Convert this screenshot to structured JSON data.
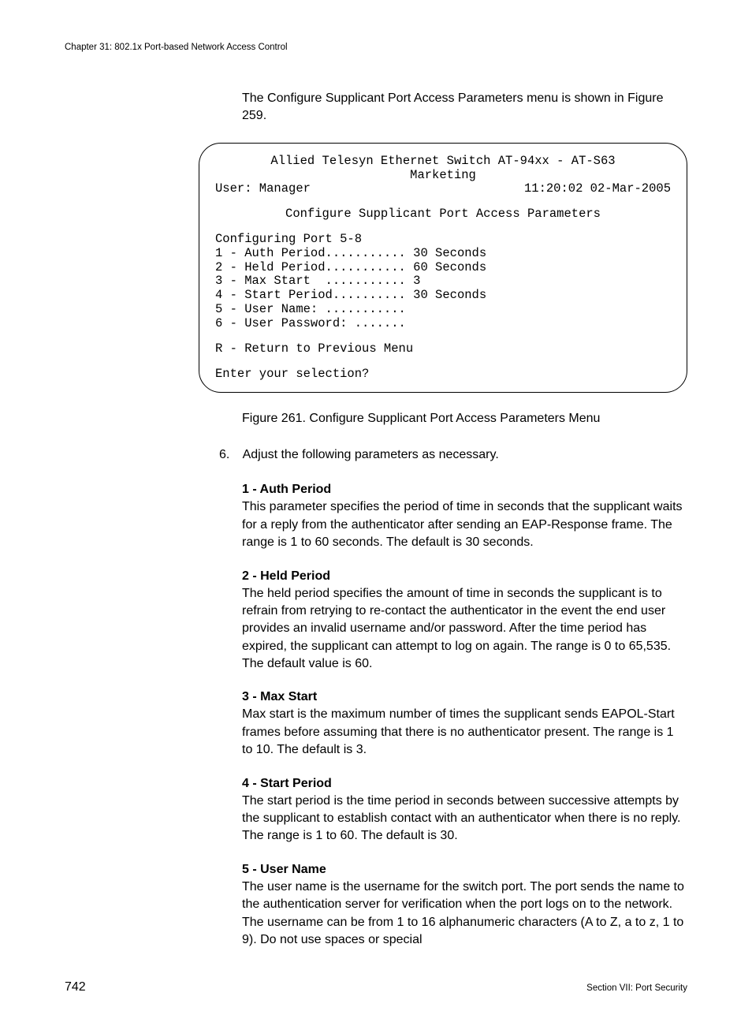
{
  "header": {
    "chapter": "Chapter 31: 802.1x Port-based Network Access Control"
  },
  "intro": "The Configure Supplicant Port Access Parameters menu is shown in Figure 259.",
  "terminal": {
    "title": "Allied Telesyn Ethernet Switch AT-94xx - AT-S63",
    "subtitle": "Marketing",
    "user_label": "User: Manager",
    "timestamp": "11:20:02 02-Mar-2005",
    "menu_title": "Configure Supplicant Port Access Parameters",
    "config_line": "Configuring Port 5-8",
    "options": [
      "1 - Auth Period........... 30 Seconds",
      "2 - Held Period........... 60 Seconds",
      "3 - Max Start  ........... 3",
      "4 - Start Period.......... 30 Seconds",
      "5 - User Name: ...........",
      "6 - User Password: ......."
    ],
    "return_line": "R - Return to Previous Menu",
    "prompt": "Enter your selection?"
  },
  "figure_caption": "Figure 261. Configure Supplicant Port Access Parameters Menu",
  "step": {
    "num": "6.",
    "text": "Adjust the following parameters as necessary."
  },
  "params": [
    {
      "title": "1 - Auth Period",
      "desc": "This parameter specifies the period of time in seconds that the supplicant waits for a reply from the authenticator after sending an EAP-Response frame. The range is 1 to 60 seconds. The default is 30 seconds."
    },
    {
      "title": "2 - Held Period",
      "desc": "The held period specifies the amount of time in seconds the supplicant is to refrain from retrying to re-contact the authenticator in the event the end user provides an invalid username and/or password. After the time period has expired, the supplicant can attempt to log on again. The range is 0 to 65,535. The default value is 60."
    },
    {
      "title": "3 - Max Start",
      "desc": "Max start is the maximum number of times the supplicant sends EAPOL-Start frames before assuming that there is no authenticator present. The range is 1 to 10. The default is 3."
    },
    {
      "title": "4 - Start Period",
      "desc": "The start period is the time period in seconds between successive attempts by the supplicant to establish contact with an authenticator when there is no reply. The range is 1 to 60. The default is 30."
    },
    {
      "title": "5 - User Name",
      "desc": "The user name is the username for the switch port. The port sends the name to the authentication server for verification when the port logs on to the network. The username can be from 1 to 16 alphanumeric characters (A to Z, a to z, 1 to 9). Do not use spaces or special"
    }
  ],
  "footer": {
    "page_number": "742",
    "section": "Section VII: Port Security"
  }
}
